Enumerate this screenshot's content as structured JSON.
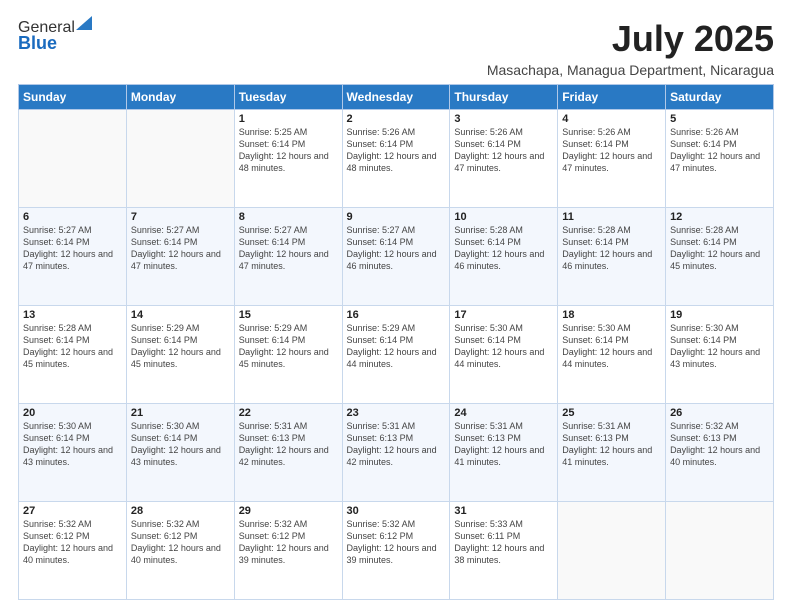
{
  "logo": {
    "general": "General",
    "blue": "Blue"
  },
  "title": "July 2025",
  "subtitle": "Masachapa, Managua Department, Nicaragua",
  "weekdays": [
    "Sunday",
    "Monday",
    "Tuesday",
    "Wednesday",
    "Thursday",
    "Friday",
    "Saturday"
  ],
  "weeks": [
    [
      {
        "day": "",
        "info": ""
      },
      {
        "day": "",
        "info": ""
      },
      {
        "day": "1",
        "info": "Sunrise: 5:25 AM\nSunset: 6:14 PM\nDaylight: 12 hours and 48 minutes."
      },
      {
        "day": "2",
        "info": "Sunrise: 5:26 AM\nSunset: 6:14 PM\nDaylight: 12 hours and 48 minutes."
      },
      {
        "day": "3",
        "info": "Sunrise: 5:26 AM\nSunset: 6:14 PM\nDaylight: 12 hours and 47 minutes."
      },
      {
        "day": "4",
        "info": "Sunrise: 5:26 AM\nSunset: 6:14 PM\nDaylight: 12 hours and 47 minutes."
      },
      {
        "day": "5",
        "info": "Sunrise: 5:26 AM\nSunset: 6:14 PM\nDaylight: 12 hours and 47 minutes."
      }
    ],
    [
      {
        "day": "6",
        "info": "Sunrise: 5:27 AM\nSunset: 6:14 PM\nDaylight: 12 hours and 47 minutes."
      },
      {
        "day": "7",
        "info": "Sunrise: 5:27 AM\nSunset: 6:14 PM\nDaylight: 12 hours and 47 minutes."
      },
      {
        "day": "8",
        "info": "Sunrise: 5:27 AM\nSunset: 6:14 PM\nDaylight: 12 hours and 47 minutes."
      },
      {
        "day": "9",
        "info": "Sunrise: 5:27 AM\nSunset: 6:14 PM\nDaylight: 12 hours and 46 minutes."
      },
      {
        "day": "10",
        "info": "Sunrise: 5:28 AM\nSunset: 6:14 PM\nDaylight: 12 hours and 46 minutes."
      },
      {
        "day": "11",
        "info": "Sunrise: 5:28 AM\nSunset: 6:14 PM\nDaylight: 12 hours and 46 minutes."
      },
      {
        "day": "12",
        "info": "Sunrise: 5:28 AM\nSunset: 6:14 PM\nDaylight: 12 hours and 45 minutes."
      }
    ],
    [
      {
        "day": "13",
        "info": "Sunrise: 5:28 AM\nSunset: 6:14 PM\nDaylight: 12 hours and 45 minutes."
      },
      {
        "day": "14",
        "info": "Sunrise: 5:29 AM\nSunset: 6:14 PM\nDaylight: 12 hours and 45 minutes."
      },
      {
        "day": "15",
        "info": "Sunrise: 5:29 AM\nSunset: 6:14 PM\nDaylight: 12 hours and 45 minutes."
      },
      {
        "day": "16",
        "info": "Sunrise: 5:29 AM\nSunset: 6:14 PM\nDaylight: 12 hours and 44 minutes."
      },
      {
        "day": "17",
        "info": "Sunrise: 5:30 AM\nSunset: 6:14 PM\nDaylight: 12 hours and 44 minutes."
      },
      {
        "day": "18",
        "info": "Sunrise: 5:30 AM\nSunset: 6:14 PM\nDaylight: 12 hours and 44 minutes."
      },
      {
        "day": "19",
        "info": "Sunrise: 5:30 AM\nSunset: 6:14 PM\nDaylight: 12 hours and 43 minutes."
      }
    ],
    [
      {
        "day": "20",
        "info": "Sunrise: 5:30 AM\nSunset: 6:14 PM\nDaylight: 12 hours and 43 minutes."
      },
      {
        "day": "21",
        "info": "Sunrise: 5:30 AM\nSunset: 6:14 PM\nDaylight: 12 hours and 43 minutes."
      },
      {
        "day": "22",
        "info": "Sunrise: 5:31 AM\nSunset: 6:13 PM\nDaylight: 12 hours and 42 minutes."
      },
      {
        "day": "23",
        "info": "Sunrise: 5:31 AM\nSunset: 6:13 PM\nDaylight: 12 hours and 42 minutes."
      },
      {
        "day": "24",
        "info": "Sunrise: 5:31 AM\nSunset: 6:13 PM\nDaylight: 12 hours and 41 minutes."
      },
      {
        "day": "25",
        "info": "Sunrise: 5:31 AM\nSunset: 6:13 PM\nDaylight: 12 hours and 41 minutes."
      },
      {
        "day": "26",
        "info": "Sunrise: 5:32 AM\nSunset: 6:13 PM\nDaylight: 12 hours and 40 minutes."
      }
    ],
    [
      {
        "day": "27",
        "info": "Sunrise: 5:32 AM\nSunset: 6:12 PM\nDaylight: 12 hours and 40 minutes."
      },
      {
        "day": "28",
        "info": "Sunrise: 5:32 AM\nSunset: 6:12 PM\nDaylight: 12 hours and 40 minutes."
      },
      {
        "day": "29",
        "info": "Sunrise: 5:32 AM\nSunset: 6:12 PM\nDaylight: 12 hours and 39 minutes."
      },
      {
        "day": "30",
        "info": "Sunrise: 5:32 AM\nSunset: 6:12 PM\nDaylight: 12 hours and 39 minutes."
      },
      {
        "day": "31",
        "info": "Sunrise: 5:33 AM\nSunset: 6:11 PM\nDaylight: 12 hours and 38 minutes."
      },
      {
        "day": "",
        "info": ""
      },
      {
        "day": "",
        "info": ""
      }
    ]
  ]
}
